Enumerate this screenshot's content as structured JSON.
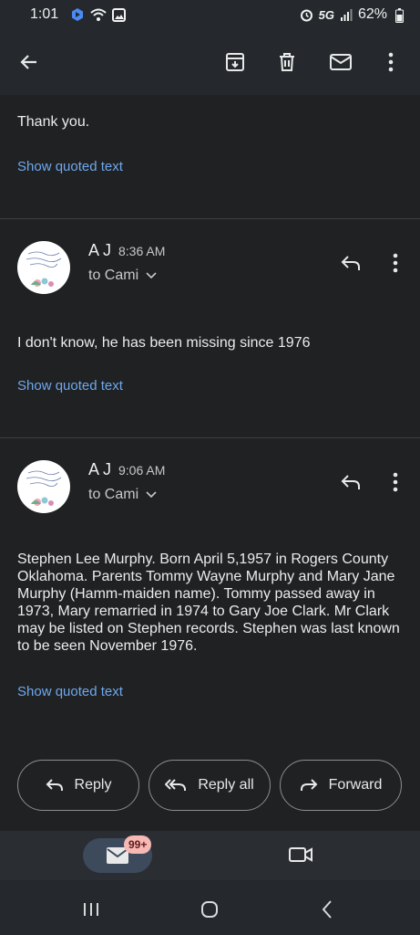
{
  "status_bar": {
    "time": "1:01",
    "network": "5G",
    "battery": "62%"
  },
  "toolbar": {
    "back_icon": "arrow-left-icon",
    "archive_icon": "archive-icon",
    "delete_icon": "trash-icon",
    "unread_icon": "mail-icon",
    "more_icon": "more-vertical-icon"
  },
  "prev_message": {
    "text": "Thank you.",
    "show_quoted": "Show quoted text"
  },
  "messages": [
    {
      "sender": "A J",
      "time": "8:36 AM",
      "to": "to Cami",
      "body": "I don't know, he has been missing since 1976",
      "show_quoted": "Show quoted text"
    },
    {
      "sender": "A J",
      "time": "9:06 AM",
      "to": "to Cami",
      "body": "Stephen Lee Murphy. Born April 5,1957 in Rogers County Oklahoma. Parents Tommy Wayne Murphy and Mary Jane Murphy (Hamm-maiden name). Tommy passed away in 1973, Mary remarried in 1974 to Gary Joe Clark. Mr Clark may be listed on Stephen records. Stephen was last known to be seen November 1976.",
      "show_quoted": "Show quoted text"
    }
  ],
  "actions": {
    "reply": "Reply",
    "reply_all": "Reply all",
    "forward": "Forward"
  },
  "bottom_nav": {
    "mail_badge": "99+"
  },
  "colors": {
    "background": "#1f2123",
    "link": "#6fa8ee",
    "badge": "#f8b8b4"
  }
}
